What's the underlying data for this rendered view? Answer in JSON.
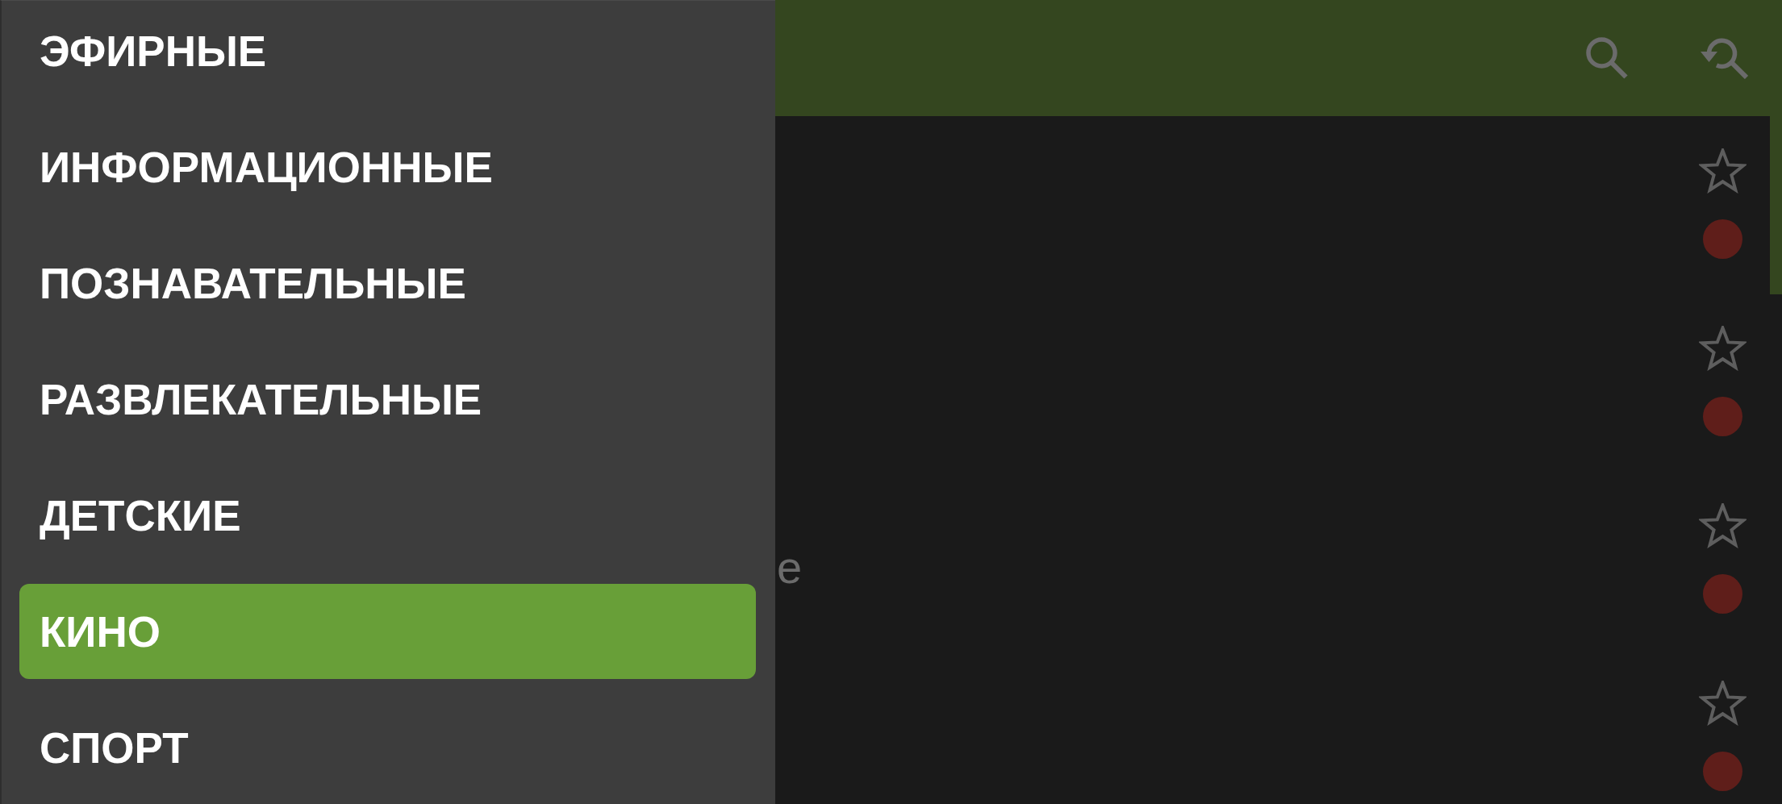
{
  "drawer": {
    "items": [
      {
        "label": "ЭФИРНЫЕ",
        "selected": false
      },
      {
        "label": "ИНФОРМАЦИОННЫЕ",
        "selected": false
      },
      {
        "label": "ПОЗНАВАТЕЛЬНЫЕ",
        "selected": false
      },
      {
        "label": "РАЗВЛЕКАТЕЛЬНЫЕ",
        "selected": false
      },
      {
        "label": "ДЕТСКИЕ",
        "selected": false
      },
      {
        "label": "КИНО",
        "selected": true
      },
      {
        "label": "СПОРТ",
        "selected": false
      }
    ]
  },
  "channels": [
    {
      "favorite": false,
      "color": "#5f1e1a"
    },
    {
      "favorite": false,
      "color": "#5f1e1a"
    },
    {
      "name": "e",
      "favorite": false,
      "color": "#5f1e1a"
    },
    {
      "favorite": false,
      "color": "#5f1e1a"
    }
  ]
}
